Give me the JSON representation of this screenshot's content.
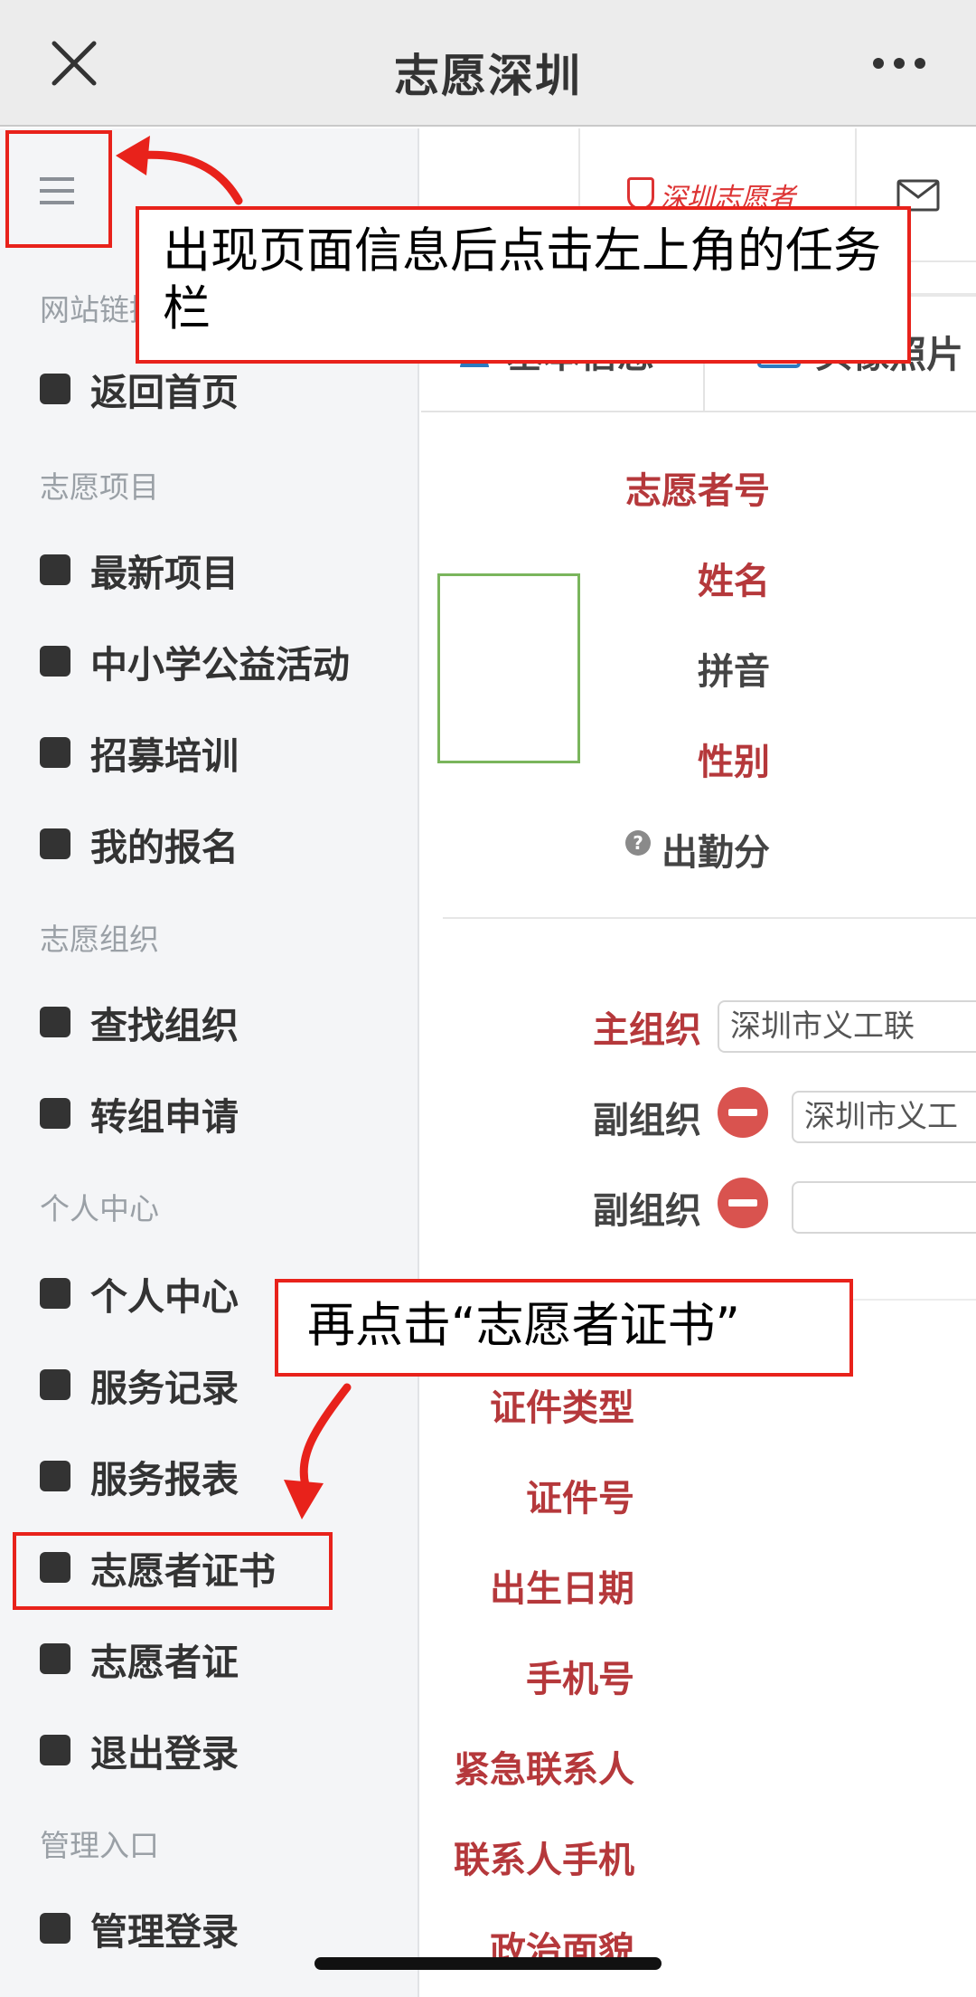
{
  "app": {
    "title": "志愿深圳"
  },
  "sidebar": {
    "sections": [
      {
        "title": "网站链接",
        "items": [
          {
            "label": "返回首页"
          }
        ]
      },
      {
        "title": "志愿项目",
        "items": [
          {
            "label": "最新项目"
          },
          {
            "label": "中小学公益活动"
          },
          {
            "label": "招募培训"
          },
          {
            "label": "我的报名"
          }
        ]
      },
      {
        "title": "志愿组织",
        "items": [
          {
            "label": "查找组织"
          },
          {
            "label": "转组申请"
          }
        ]
      },
      {
        "title": "个人中心",
        "items": [
          {
            "label": "个人中心"
          },
          {
            "label": "服务记录"
          },
          {
            "label": "服务报表"
          },
          {
            "label": "志愿者证书"
          },
          {
            "label": "志愿者证"
          },
          {
            "label": "退出登录"
          }
        ]
      },
      {
        "title": "管理入口",
        "items": [
          {
            "label": "管理登录"
          }
        ]
      }
    ]
  },
  "main": {
    "brand": "深圳志愿者",
    "tabs": [
      {
        "label": "基本信息"
      },
      {
        "label": "头像照片"
      }
    ],
    "basic_fields": [
      "志愿者号",
      "姓名",
      "拼音",
      "性别",
      "出勤分"
    ],
    "org": {
      "main_label": "主组织",
      "main_value": "深圳市义工联",
      "sub_label_1": "副组织",
      "sub_value_1": "深圳市义工",
      "sub_label_2": "副组织",
      "sub_value_2": ""
    },
    "id_fields": [
      "证件类型",
      "证件号",
      "出生日期",
      "手机号",
      "紧急联系人",
      "联系人手机",
      "政治面貌"
    ]
  },
  "annotations": {
    "callout_1": "出现页面信息后点击左上角的任务栏",
    "callout_2": "再点击“志愿者证书”",
    "color": "#e8221b"
  }
}
